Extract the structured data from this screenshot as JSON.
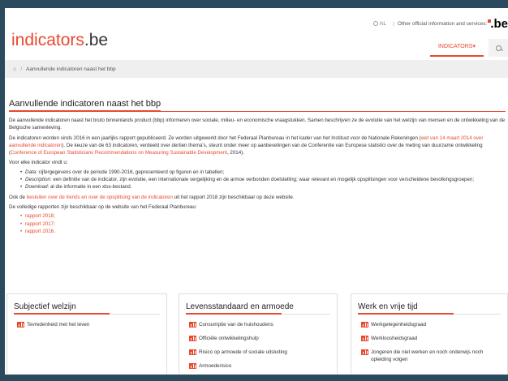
{
  "header": {
    "logo_main": "indicators",
    "logo_ext": ".be",
    "lang": "NL",
    "other_sites": "Other official information and services:",
    "be_logo": ".be",
    "nav_indicators": "INDICATORS",
    "nav_caret": "▾"
  },
  "breadcrumb": {
    "home_icon": "⌂",
    "separator": "/",
    "current": "Aanvullende indicatoren naast het bbp"
  },
  "article": {
    "title": "Aanvullende indicatoren naast het bbp",
    "p1": "De aanvullende indicatoren naast het bruto binnenlands product (bbp) informeren over sociale, milieu- en economische vraagstukken. Samen beschrijven ze de evolutie van het welzijn van mensen en de ontwikkeling van de Belgische samenleving.",
    "p2_a": "De indicatoren worden sinds 2016 in een jaarlijks rapport gepubliceerd. Ze worden uitgewerkt door het Federaal Planbureau in het kader van het Instituut voor de Nationale Rekeningen (",
    "p2_link1": "wet van 14 maart 2014 over aanvullende indicatoren",
    "p2_b": "). De keuze van de 63 indicatoren, verdeeld over dertien thema's, steunt onder meer op aanbevelingen van de Conferentie van Europese statistici over de meting van duurzame ontwikkeling (",
    "p2_link2": "Conference of European Statisticians Recommendations on Measuring Sustainable Development",
    "p2_c": ", 2014).",
    "p3": "Voor elke indicator vindt u:",
    "bullets": [
      {
        "label": "Data",
        "text": ": cijfergegevens over de periode 1990-2016, gepresenteerd op figuren en in tabellen;"
      },
      {
        "label": "Description",
        "text": ": een definitie van de indicator, zijn evolutie, een internationale vergelijking en de armoe verbonden doelstelling; waar relevant en mogelijk opsplitsingen voor verscheidene bevolkingsgroepen;"
      },
      {
        "label": "Download",
        "text": ": al die informatie in een xlsx-bestand."
      }
    ],
    "p4_a": "Ook de ",
    "p4_link": "besluiten over de trends en over de opsplitsing van de indicatoren",
    "p4_b": " uit het rapport 2018 zijn beschikbaar op deze website.",
    "p5": "De volledige rapporten zijn beschikbaar op de website van het Federaal Planbureau:",
    "reports": [
      "rapport 2018;",
      "rapport 2017;",
      "rapport 2016."
    ]
  },
  "cards": [
    {
      "title": "Subjectief welzijn",
      "items": [
        "Tevredenheid met het leven"
      ]
    },
    {
      "title": "Levensstandaard en armoede",
      "items": [
        "Consumptie van de huishoudens",
        "Officiële ontwikkelingshulp",
        "Risico op armoede of sociale uitsluiting",
        "Armoederisico"
      ]
    },
    {
      "title": "Werk en vrije tijd",
      "items": [
        "Werkgelegenheidsgraad",
        "Werkloosheidsgraad",
        "Jongeren die niet werken en noch onderwijs noch opleiding volgen"
      ]
    }
  ],
  "colors": {
    "accent": "#e8492e",
    "frame": "#2b4a5e"
  }
}
